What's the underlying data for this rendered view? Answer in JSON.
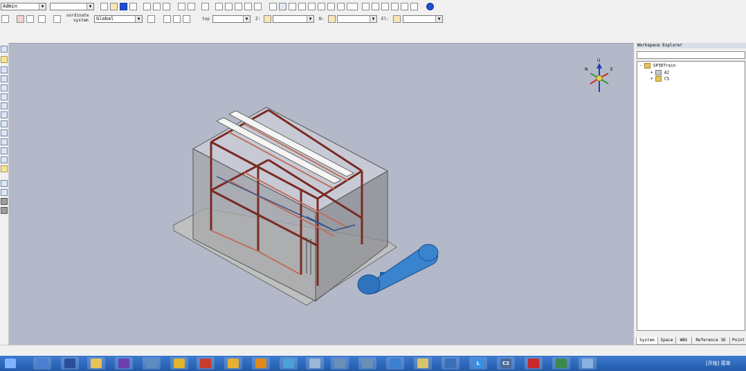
{
  "toolbar": {
    "permission_group": "Admin",
    "filter_combo": "",
    "coordinate_label_line1": "oordinate",
    "coordinate_label_line2": "system",
    "coordinate_system": "Global",
    "top_label": "top",
    "z_label": "Z:",
    "n_label": "N:",
    "el_label": "El:",
    "top_value": "",
    "z_value": "",
    "n_value": "",
    "el_value": ""
  },
  "workspace_explorer": {
    "title": "Workspace Explorer",
    "search_value": "",
    "tree": [
      {
        "label": "SP3DTrain",
        "level": 0,
        "expand": "-"
      },
      {
        "label": "A2",
        "level": 1,
        "expand": "+"
      },
      {
        "label": "CS",
        "level": 1,
        "expand": "+"
      }
    ],
    "tabs": [
      {
        "label": "System",
        "active": true
      },
      {
        "label": "Space",
        "active": false
      },
      {
        "label": "WBS",
        "active": false
      },
      {
        "label": "Reference 3D",
        "active": false
      },
      {
        "label": "Point",
        "active": false
      }
    ]
  },
  "compass": {
    "up": "U",
    "north": "N",
    "east": "E"
  },
  "taskbar": {
    "apps": [
      {
        "name": "start-button-icon",
        "text": "",
        "color": "#7fb3ff"
      },
      {
        "name": "server-manager-icon",
        "text": "",
        "color": "#4a7fd0"
      },
      {
        "name": "powershell-icon",
        "text": "",
        "color": "#2a4f9a"
      },
      {
        "name": "file-explorer-icon",
        "text": "",
        "color": "#e6c35a"
      },
      {
        "name": "visual-studio-icon",
        "text": "",
        "color": "#6b3fb0"
      },
      {
        "name": "tools-icon",
        "text": "",
        "color": "#5c8cc2"
      },
      {
        "name": "hazard-icon",
        "text": "",
        "color": "#e2b430"
      },
      {
        "name": "red-app-icon",
        "text": "",
        "color": "#c83a2a"
      },
      {
        "name": "chrome-icon",
        "text": "",
        "color": "#e6b033"
      },
      {
        "name": "search-app-icon",
        "text": "",
        "color": "#e08a1a"
      },
      {
        "name": "network-icon",
        "text": "",
        "color": "#4aa2d8"
      },
      {
        "name": "paint-icon",
        "text": "",
        "color": "#9bb7d6"
      },
      {
        "name": "smartplant-icon",
        "text": "",
        "color": "#6b8fb8"
      },
      {
        "name": "smartplant-2-icon",
        "text": "",
        "color": "#6b8fb8"
      },
      {
        "name": "download-icon",
        "text": "",
        "color": "#3b7fd0"
      },
      {
        "name": "notes-icon",
        "text": "",
        "color": "#d9c46a"
      },
      {
        "name": "hierarchy-icon",
        "text": "",
        "color": "#3a6fb5"
      },
      {
        "name": "l-app-icon",
        "text": "L",
        "color": "#3b8fe0"
      },
      {
        "name": "c2-app-icon",
        "text": "C2",
        "color": "#4a6a98"
      },
      {
        "name": "acrobat-icon",
        "text": "",
        "color": "#c8282a"
      },
      {
        "name": "excel-icon",
        "text": "",
        "color": "#3a8a4a"
      },
      {
        "name": "window-icon",
        "text": "",
        "color": "#8ab2e0"
      }
    ],
    "tray_text": "[开始] 菜单"
  }
}
